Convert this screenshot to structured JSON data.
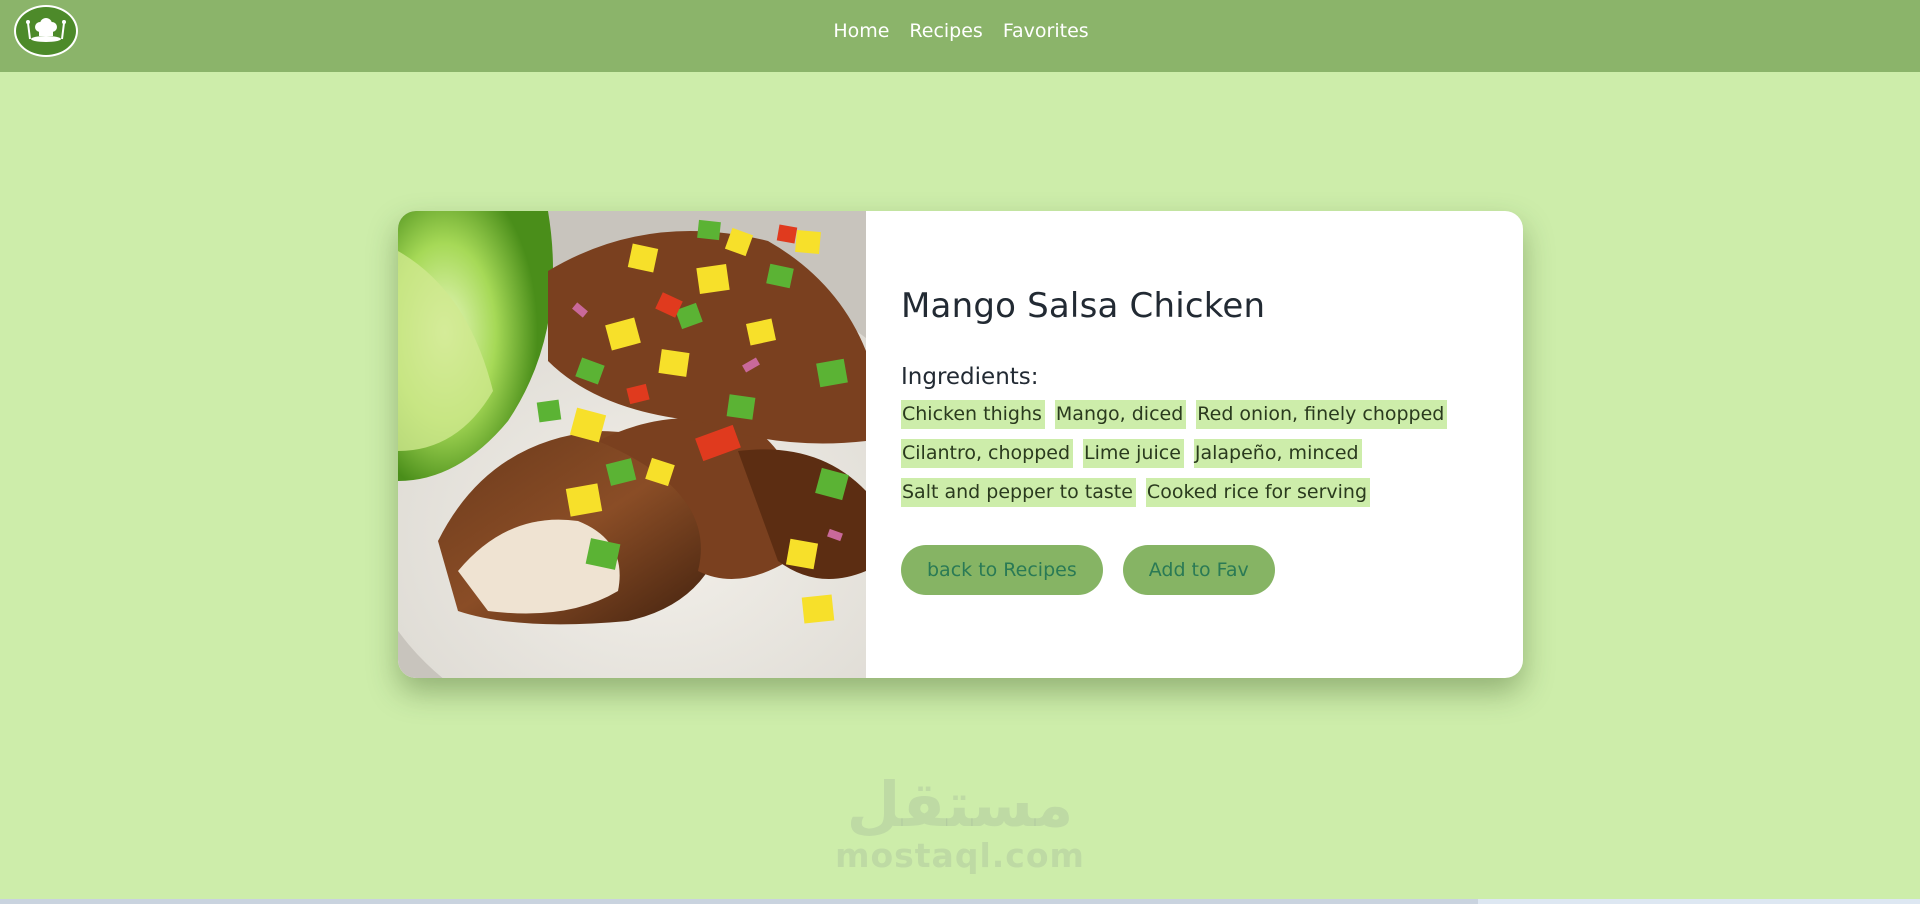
{
  "nav": {
    "links": [
      "Home",
      "Recipes",
      "Favorites"
    ],
    "logo_icon": "chef-hat-logo-icon",
    "bar_color": "#8bb46a"
  },
  "recipe": {
    "title": "Mango Salsa Chicken",
    "image_icon": "mango-salsa-chicken-photo",
    "ingredients_heading": "Ingredients:",
    "ingredient_rows": [
      [
        "Chicken thighs",
        "Mango, diced",
        "Red onion, finely chopped"
      ],
      [
        "Cilantro, chopped",
        "Lime juice",
        "Jalapeño, minced"
      ],
      [
        "Salt and pepper to taste",
        "Cooked rice for serving"
      ]
    ],
    "buttons": {
      "back": "back to Recipes",
      "fav": "Add to Fav"
    }
  },
  "watermark": {
    "arabic": "مستقل",
    "latin": "mostaql.com"
  },
  "colors": {
    "page_bg": "#cdedaa",
    "accent": "#86b464",
    "button_text": "#2a7a55"
  }
}
